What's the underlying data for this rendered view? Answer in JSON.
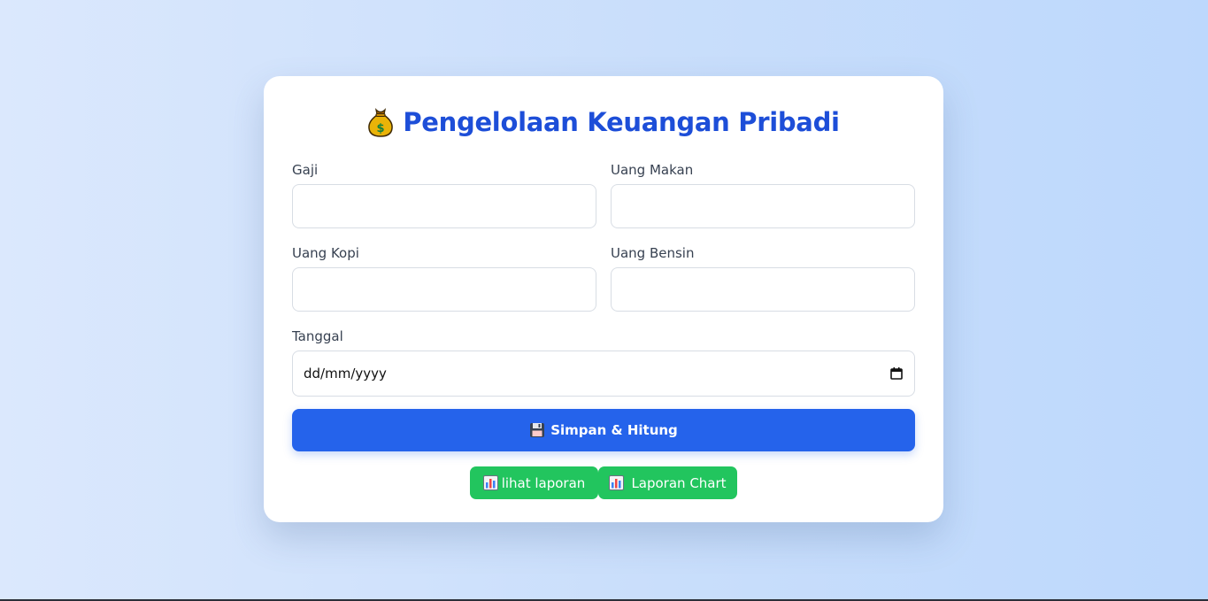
{
  "header": {
    "icon": "money-bag-icon",
    "title": "Pengelolaan Keuangan Pribadi"
  },
  "form": {
    "gaji": {
      "label": "Gaji",
      "value": "",
      "placeholder": ""
    },
    "uang_makan": {
      "label": "Uang Makan",
      "value": "",
      "placeholder": ""
    },
    "uang_kopi": {
      "label": "Uang Kopi",
      "value": "",
      "placeholder": ""
    },
    "uang_bensin": {
      "label": "Uang Bensin",
      "value": "",
      "placeholder": ""
    },
    "tanggal": {
      "label": "Tanggal",
      "value": "dd/mm/yyyy",
      "icon": "calendar-icon"
    }
  },
  "actions": {
    "save": {
      "icon": "floppy-disk-icon",
      "label": "Simpan & Hitung"
    },
    "lihat_laporan": {
      "icon": "bar-chart-icon",
      "label": "lihat laporan"
    },
    "laporan_chart": {
      "icon": "bar-chart-icon",
      "label": "Laporan Chart"
    }
  },
  "colors": {
    "primary": "#2563eb",
    "title": "#1d4ed8",
    "success": "#22c55e",
    "card_bg": "#ffffff",
    "page_bg_start": "#dbe8fd",
    "page_bg_end": "#bdd8fc"
  }
}
